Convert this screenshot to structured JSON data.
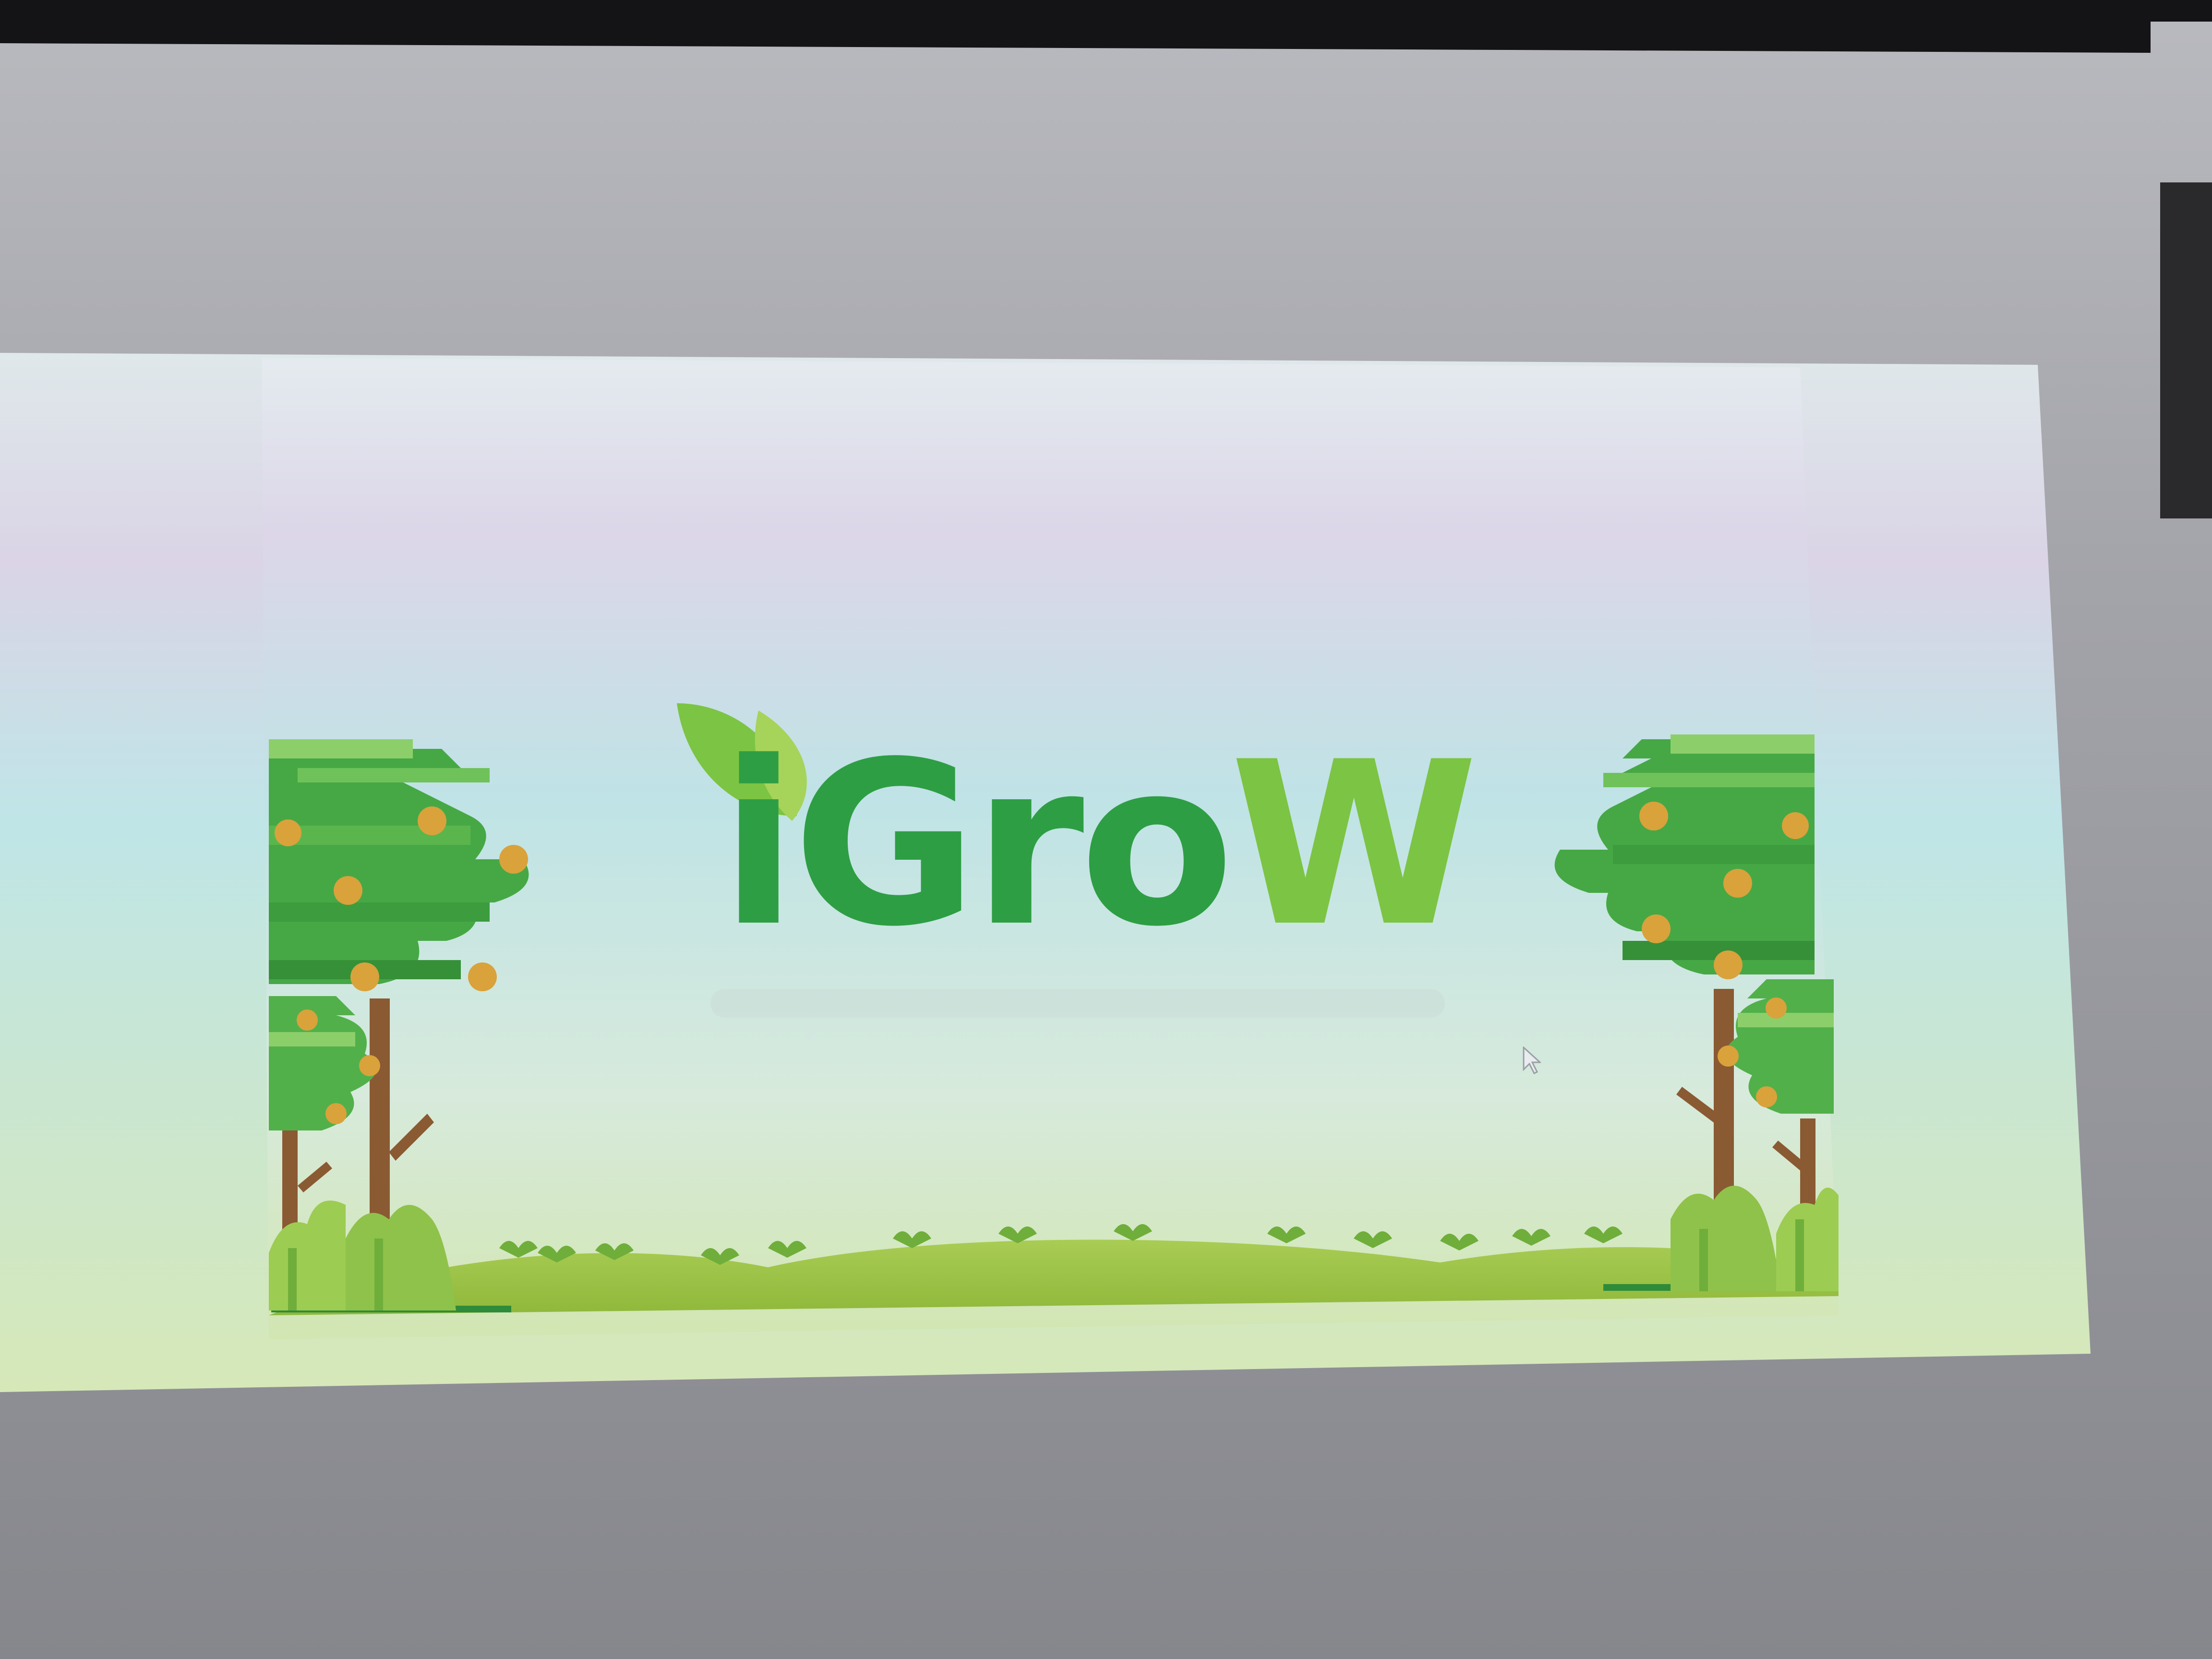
{
  "slide": {
    "logo": {
      "wordmark_main": "iGro",
      "wordmark_end": "W",
      "icon": "leaf-icon"
    }
  },
  "colors": {
    "wall": "#8f8f93",
    "screen_frame": "#141416",
    "slide_sky_top": "#dfe6ee",
    "slide_sky_mid": "#bfe0e6",
    "slide_grass": "#cfe3a8",
    "logo_green_dark": "#2e9e44",
    "logo_green_light": "#7cc443",
    "tree_canopy": "#46a845",
    "tree_trunk": "#8a5a33",
    "fruit": "#d9a23b"
  }
}
